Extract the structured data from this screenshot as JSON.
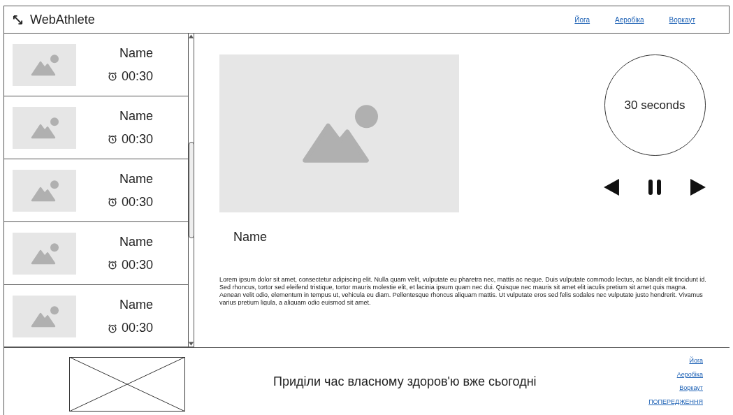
{
  "header": {
    "title": "WebAthlete",
    "nav": [
      "Йога",
      "Аеробіка",
      "Воркаут"
    ]
  },
  "exercises": [
    {
      "name": "Name",
      "time": "00:30"
    },
    {
      "name": "Name",
      "time": "00:30"
    },
    {
      "name": "Name",
      "time": "00:30"
    },
    {
      "name": "Name",
      "time": "00:30"
    },
    {
      "name": "Name",
      "time": "00:30"
    }
  ],
  "player": {
    "name": "Name",
    "timer": "30 seconds",
    "description": "Lorem ipsum dolor sit amet, consectetur adipiscing elit. Nulla quam velit, vulputate eu pharetra nec, mattis ac neque. Duis vulputate commodo lectus, ac blandit elit tincidunt id. Sed rhoncus, tortor sed eleifend tristique, tortor mauris molestie elit, et lacinia ipsum quam nec dui. Quisque nec mauris sit amet elit iaculis pretium sit amet quis magna. Aenean velit odio, elementum in tempus ut, vehicula eu diam. Pellentesque rhoncus aliquam mattis. Ut vulputate eros sed felis sodales nec vulputate justo hendrerit. Vivamus varius pretium ligula, a aliquam odio euismod sit amet."
  },
  "footer": {
    "slogan": "Приділи час власному здоров'ю вже сьогодні",
    "links": [
      "Йога",
      "Аеробіка",
      "Воркаут",
      "ПОПЕРЕДЖЕННЯ"
    ]
  }
}
